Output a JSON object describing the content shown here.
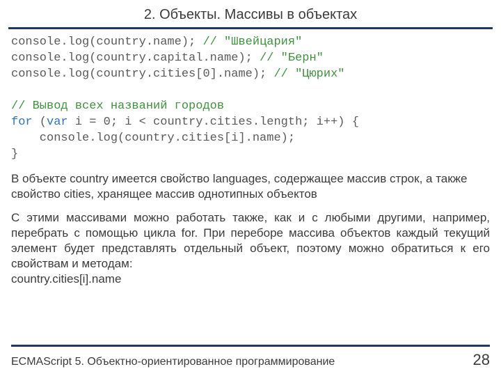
{
  "header": {
    "title": "2. Объекты. Массивы в объектах"
  },
  "code": {
    "l1a": "console.log(country.name); ",
    "l1c": "// \"Швейцария\"",
    "l2a": "console.log(country.capital.name); ",
    "l2c": "// \"Берн\"",
    "l3a": "console.log(country.cities[0].name); ",
    "l3c": "// \"Цюрих\"",
    "l5c": "// Вывод всех названий городов",
    "l6kw": "for",
    "l6a": " (",
    "l6kw2": "var",
    "l6b": " i = 0; i < country.cities.length; i++) {",
    "l7": "    console.log(country.cities[i].name);",
    "l8": "}"
  },
  "para1": "В объекте country имеется свойство languages, содержащее массив строк, а также свойство cities, хранящее массив однотипных объектов",
  "para2": "С этими массивами можно работать также, как и с любыми другими, например, перебрать с помощью цикла for. При переборе массива объектов каждый текущий элемент будет представлять отдельный объект, поэтому можно обратиться к его свойствам и методам:",
  "para3": "country.cities[i].name",
  "footer": {
    "title": "ECMAScript 5. Объектно-ориентированное программирование",
    "page": "28"
  }
}
